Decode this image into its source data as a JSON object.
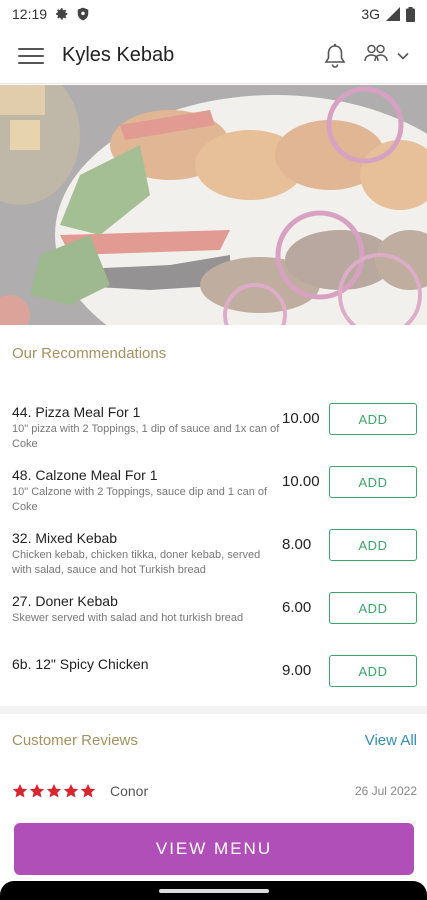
{
  "status_bar": {
    "time": "12:19",
    "network": "3G"
  },
  "app_bar": {
    "title": "Kyles Kebab"
  },
  "recommendations": {
    "title": "Our Recommendations",
    "items": [
      {
        "name": "44. Pizza Meal For 1",
        "description": "10\" pizza with 2 Toppings, 1 dip of sauce and 1x can of Coke",
        "price": "10.00",
        "add_label": "ADD"
      },
      {
        "name": "48. Calzone Meal For 1",
        "description": "10\" Calzone with 2 Toppings, sauce dip and 1 can of Coke",
        "price": "10.00",
        "add_label": "ADD"
      },
      {
        "name": "32. Mixed Kebab",
        "description": "Chicken kebab, chicken tikka, doner kebab, served with salad, sauce and hot Turkish bread",
        "price": "8.00",
        "add_label": "ADD"
      },
      {
        "name": "27. Doner Kebab",
        "description": "Skewer served with salad and hot turkish bread",
        "price": "6.00",
        "add_label": "ADD"
      },
      {
        "name": "6b. 12\" Spicy Chicken",
        "description": "",
        "price": "9.00",
        "add_label": "ADD"
      }
    ]
  },
  "reviews": {
    "title": "Customer Reviews",
    "view_all_label": "View All",
    "items": [
      {
        "rating": 5,
        "reviewer": "Conor",
        "date": "26 Jul 2022"
      }
    ]
  },
  "view_menu_label": "VIEW MENU",
  "colors": {
    "accent_gold": "#a6905e",
    "add_green": "#3aa76a",
    "link_blue": "#2f8fb5",
    "primary_purple": "#b14fb8",
    "star_red": "#d7262f"
  }
}
